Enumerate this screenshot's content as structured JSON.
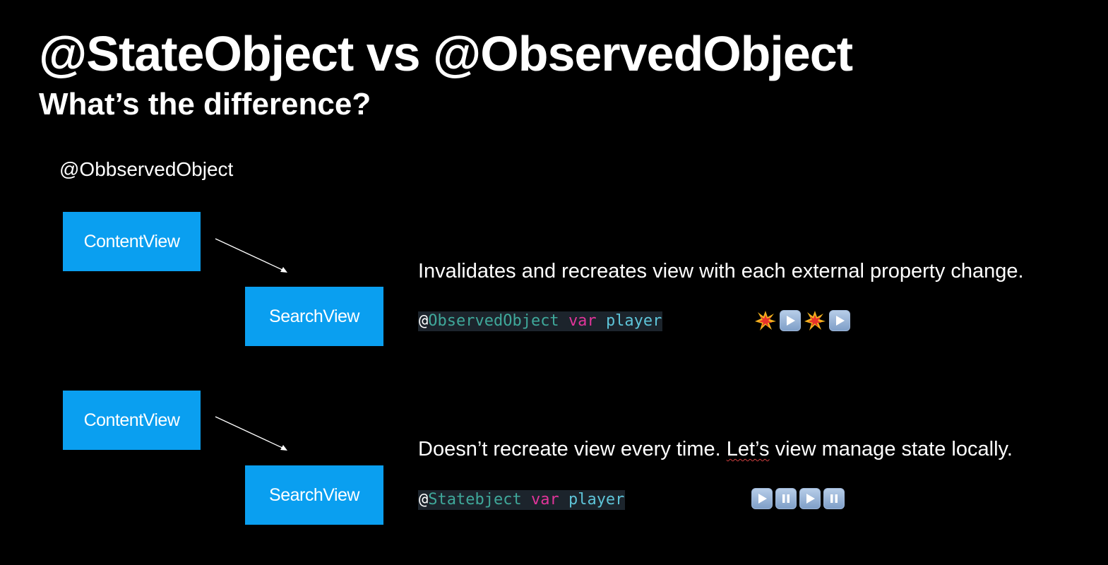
{
  "slide": {
    "title": "@StateObject vs @ObservedObject",
    "subtitle": "What’s the difference?",
    "section_label": "@ObbservedObject"
  },
  "diagram_top": {
    "parent": "ContentView",
    "child": "SearchView",
    "description": "Invalidates and recreates view with each external property change.",
    "code": {
      "at": "@",
      "type": "ObservedObject",
      "keyword": "var",
      "name": "player"
    },
    "icons": [
      "collision-icon",
      "play-icon",
      "collision-icon",
      "play-icon"
    ]
  },
  "diagram_bottom": {
    "parent": "ContentView",
    "child": "SearchView",
    "description_pre": "Doesn’t recreate view every time. ",
    "description_underlined": "Let’s",
    "description_post": " view manage state locally.",
    "code": {
      "at": "@",
      "type": "Statebject",
      "keyword": "var",
      "name": "player"
    },
    "icons": [
      "play-icon",
      "pause-icon",
      "play-icon",
      "pause-icon"
    ]
  },
  "colors": {
    "background": "#000000",
    "box": "#0a9ff0",
    "code_type": "#3fa89a",
    "code_keyword": "#e0359a",
    "code_ident": "#5ec4d8"
  }
}
